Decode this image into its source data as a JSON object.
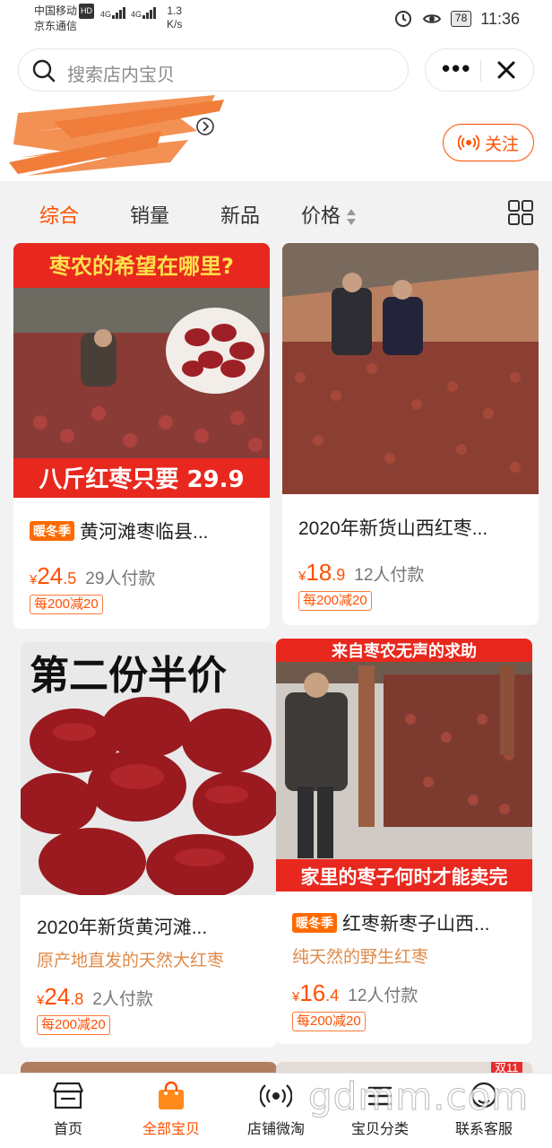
{
  "status_bar": {
    "carrier1": "中国移动",
    "carrier1_badge": "HD",
    "carrier2": "京东通信",
    "net1": "4G",
    "net2": "4G",
    "speed_value": "1.3",
    "speed_unit": "K/s",
    "battery": "78",
    "time": "11:36"
  },
  "search": {
    "placeholder": "搜索店内宝贝"
  },
  "capsule": {
    "more": "•••",
    "close": "✕"
  },
  "store": {
    "follow_label": "关注"
  },
  "sort_tabs": [
    "综合",
    "销量",
    "新品",
    "价格"
  ],
  "products": [
    {
      "banner_top": "枣农的希望在哪里?",
      "banner_bottom": "八斤红枣只要 29.9",
      "tag": "暖冬季",
      "title": "黄河滩枣临县...",
      "price_int": "24",
      "price_dec": ".5",
      "currency": "¥",
      "paid": "29人付款",
      "coupon": "每200减20"
    },
    {
      "title": "2020年新货山西红枣...",
      "price_int": "18",
      "price_dec": ".9",
      "currency": "¥",
      "paid": "12人付款",
      "coupon": "每200减20"
    },
    {
      "banner_top": "第二份半价",
      "title": "2020年新货黄河滩...",
      "subtitle": "原产地直发的天然大红枣",
      "price_int": "24",
      "price_dec": ".8",
      "currency": "¥",
      "paid": "2人付款",
      "coupon": "每200减20"
    },
    {
      "banner_top": "来自枣农无声的求助",
      "banner_bottom": "家里的枣子何时才能卖完",
      "tag": "暖冬季",
      "title": "红枣新枣子山西...",
      "subtitle": "纯天然的野生红枣",
      "price_int": "16",
      "price_dec": ".4",
      "currency": "¥",
      "paid": "12人付款",
      "coupon": "每200减20"
    }
  ],
  "peek_badge": "双11",
  "bottom_nav": [
    {
      "label": "首页",
      "icon": "store-icon"
    },
    {
      "label": "全部宝贝",
      "icon": "shopping-bag-icon"
    },
    {
      "label": "店铺微淘",
      "icon": "broadcast-icon"
    },
    {
      "label": "宝贝分类",
      "icon": "category-icon"
    },
    {
      "label": "联系客服",
      "icon": "chat-icon"
    }
  ],
  "watermark": "gdmm.com",
  "colors": {
    "accent": "#ff5000",
    "banner_red": "#e8281e",
    "coupon_border": "#ff7a3a"
  }
}
